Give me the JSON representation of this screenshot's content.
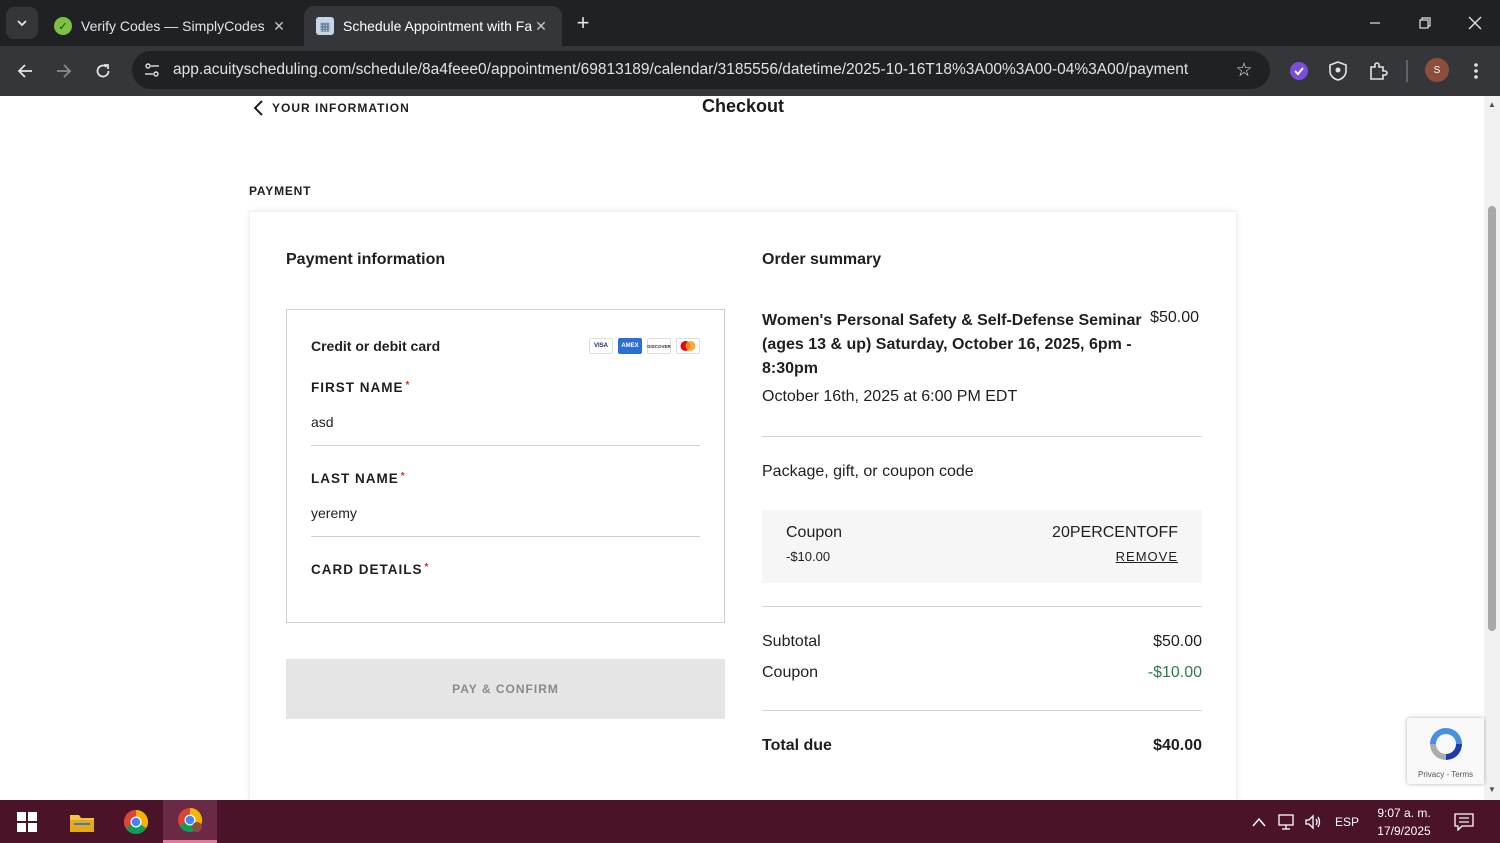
{
  "browser": {
    "tabs": [
      {
        "title": "Verify Codes — SimplyCodes",
        "active": false
      },
      {
        "title": "Schedule Appointment with Far",
        "active": true
      }
    ],
    "url": "app.acuityscheduling.com/schedule/8a4feee0/appointment/69813189/calendar/3185556/datetime/2025-10-16T18%3A00%3A00-04%3A00/payment",
    "profile_initial": "S"
  },
  "page": {
    "back_label": "YOUR INFORMATION",
    "title": "Checkout",
    "section_label": "PAYMENT"
  },
  "payment": {
    "heading": "Payment information",
    "method_label": "Credit or debit card",
    "card_brands": [
      "VISA",
      "AMEX",
      "DISCOVER",
      "MASTERCARD"
    ],
    "first_name_label": "FIRST NAME",
    "first_name_value": "asd",
    "last_name_label": "LAST NAME",
    "last_name_value": "yeremy",
    "card_details_label": "CARD DETAILS",
    "required_mark": "*",
    "pay_button": "PAY & CONFIRM"
  },
  "order": {
    "heading": "Order summary",
    "item_title": "Women's Personal Safety & Self-Defense Seminar (ages 13 & up) Saturday, October 16, 2025, 6pm - 8:30pm",
    "item_price": "$50.00",
    "item_date": "October 16th, 2025 at 6:00 PM EDT",
    "coupon_section_label": "Package, gift, or coupon code",
    "coupon": {
      "name": "Coupon",
      "amount": "-$10.00",
      "code": "20PERCENTOFF",
      "remove_label": "REMOVE"
    },
    "subtotal_label": "Subtotal",
    "subtotal_value": "$50.00",
    "discount_label": "Coupon",
    "discount_value": "-$10.00",
    "total_label": "Total due",
    "total_value": "$40.00"
  },
  "recaptcha": {
    "text": "Privacy - Terms"
  },
  "taskbar": {
    "language": "ESP",
    "time": "9:07 a. m.",
    "date": "17/9/2025"
  },
  "colors": {
    "accent_green": "#2e7d4f",
    "required_red": "#d0342c",
    "taskbar": "#4a1329"
  }
}
